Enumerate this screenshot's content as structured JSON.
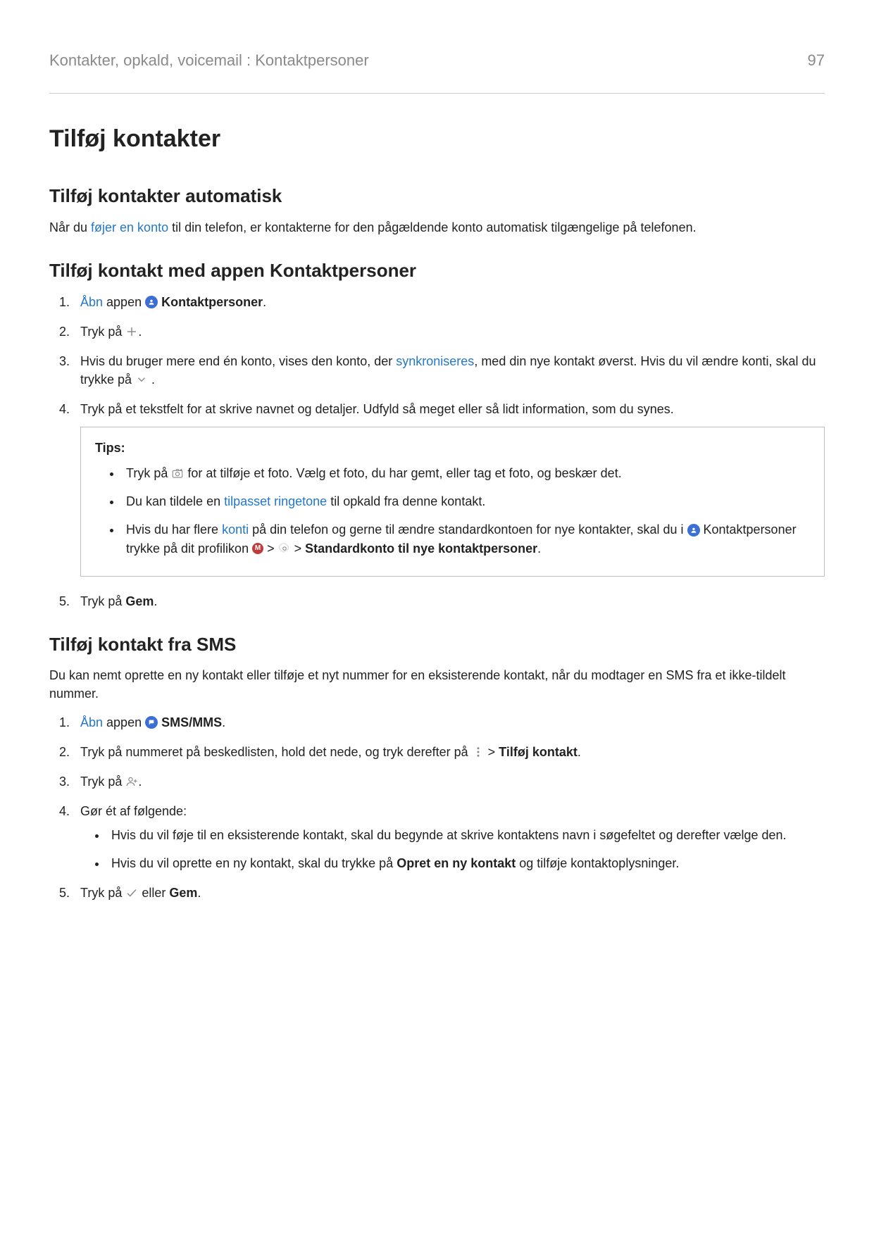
{
  "header": {
    "breadcrumb": "Kontakter, opkald, voicemail : Kontaktpersoner",
    "page_number": "97"
  },
  "title": "Tilføj kontakter",
  "section_auto": {
    "heading": "Tilføj kontakter automatisk",
    "para_pre": "Når du ",
    "para_link": "føjer en konto",
    "para_post": " til din telefon, er kontakterne for den pågældende konto automatisk tilgængelige på telefonen."
  },
  "section_app": {
    "heading": "Tilføj kontakt med appen Kontaktpersoner",
    "step1_link": "Åbn",
    "step1_mid": " appen ",
    "step1_app_name": "Kontaktpersoner",
    "step1_end": ".",
    "step2_pre": "Tryk på ",
    "step2_end": ".",
    "step3_pre": "Hvis du bruger mere end én konto, vises den konto, der ",
    "step3_link": "synkroniseres",
    "step3_post": ", med din nye kontakt øverst. Hvis du vil ændre konti, skal du trykke på ",
    "step3_end": " .",
    "step4": "Tryk på et tekstfelt for at skrive navnet og detaljer. Udfyld så meget eller så lidt information, som du synes.",
    "step5_pre": "Tryk på ",
    "step5_bold": "Gem",
    "step5_end": "."
  },
  "tips": {
    "title": "Tips:",
    "t1_pre": "Tryk på ",
    "t1_post": " for at tilføje et foto. Vælg et foto, du har gemt, eller tag et foto, og beskær det.",
    "t2_pre": "Du kan tildele en ",
    "t2_link": "tilpasset ringetone",
    "t2_post": " til opkald fra denne kontakt.",
    "t3_pre": "Hvis du har flere ",
    "t3_link": "konti",
    "t3_mid1": " på din telefon og gerne til ændre standardkontoen for nye kontakter, skal du i ",
    "t3_mid2": " Kontaktpersoner trykke på dit profilikon ",
    "t3_gt1": " > ",
    "t3_gt2": " > ",
    "t3_bold": "Standardkonto til nye kontaktpersoner",
    "t3_end": ".",
    "profile_letter": "M"
  },
  "section_sms": {
    "heading": "Tilføj kontakt fra SMS",
    "para": "Du kan nemt oprette en ny kontakt eller tilføje et nyt nummer for en eksisterende kontakt, når du modtager en SMS fra et ikke-tildelt nummer.",
    "step1_link": "Åbn",
    "step1_mid": " appen ",
    "step1_app_name": "SMS/MMS",
    "step1_end": ".",
    "step2_pre": "Tryk på nummeret på beskedlisten, hold det nede, og tryk derefter på ",
    "step2_gt": " > ",
    "step2_bold": "Tilføj kontakt",
    "step2_end": ".",
    "step3_pre": "Tryk på ",
    "step3_end": ".",
    "step4_intro": "Gør ét af følgende:",
    "step4_a": "Hvis du vil føje til en eksisterende kontakt, skal du begynde at skrive kontaktens navn i søgefeltet og derefter vælge den.",
    "step4_b_pre": "Hvis du vil oprette en ny kontakt, skal du trykke på ",
    "step4_b_bold": "Opret en ny kontakt",
    "step4_b_post": " og tilføje kontaktoplysninger.",
    "step5_pre": "Tryk på ",
    "step5_mid": " eller ",
    "step5_bold": "Gem",
    "step5_end": "."
  }
}
